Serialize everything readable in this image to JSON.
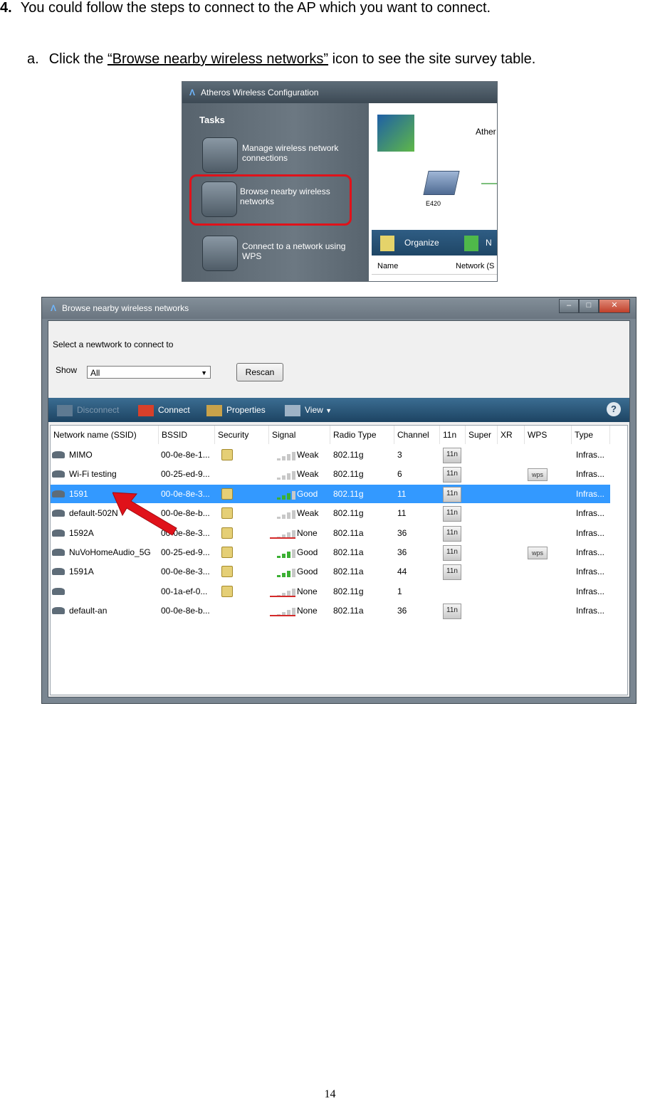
{
  "step": {
    "number": "4.",
    "text": "You could follow the steps to connect to the AP which you want to connect."
  },
  "substep": {
    "label": "a.",
    "before": "Click the ",
    "link": "“Browse nearby wireless networks”",
    "after": " icon to see the site survey table."
  },
  "screenshot1": {
    "window_title": "Atheros Wireless Configuration",
    "tasks_heading": "Tasks",
    "tasks": [
      {
        "label": "Manage wireless network connections",
        "icon": "network-manage-icon",
        "highlighted": false
      },
      {
        "label": "Browse nearby wireless networks",
        "icon": "magnifier-icon",
        "highlighted": true
      },
      {
        "label": "Connect to a network using WPS",
        "icon": "wps-lock-icon",
        "highlighted": false
      }
    ],
    "brand_text": "Ather",
    "laptop_label": "E420",
    "toolbar": {
      "organize": "Organize",
      "n": "N"
    },
    "columns": [
      "Name",
      "Network (S"
    ],
    "highlight_color": "#e0121a"
  },
  "screenshot2": {
    "window_title": "Browse nearby wireless networks",
    "prompt": "Select a newtwork to connect to",
    "show_label": "Show",
    "show_value": "All",
    "rescan_label": "Rescan",
    "toolbar": {
      "disconnect": "Disconnect",
      "connect": "Connect",
      "properties": "Properties",
      "view": "View"
    },
    "columns": [
      "Network name (SSID)",
      "BSSID",
      "Security",
      "Signal",
      "Radio Type",
      "Channel",
      "11n",
      "Super",
      "XR",
      "WPS",
      "Type"
    ],
    "networks": [
      {
        "ssid": "MIMO",
        "bssid": "00-0e-8e-1...",
        "secured": true,
        "signal": "Weak",
        "bars": 1,
        "radio": "802.11g",
        "channel": "3",
        "n11": true,
        "wps": false,
        "type": "Infras...",
        "selected": false
      },
      {
        "ssid": "Wi-Fi testing",
        "bssid": "00-25-ed-9...",
        "secured": false,
        "signal": "Weak",
        "bars": 1,
        "radio": "802.11g",
        "channel": "6",
        "n11": true,
        "wps": true,
        "type": "Infras...",
        "selected": false
      },
      {
        "ssid": "1591",
        "bssid": "00-0e-8e-3...",
        "secured": true,
        "signal": "Good",
        "bars": 3,
        "radio": "802.11g",
        "channel": "11",
        "n11": true,
        "wps": false,
        "type": "Infras...",
        "selected": true
      },
      {
        "ssid": "default-502N",
        "bssid": "00-0e-8e-b...",
        "secured": true,
        "signal": "Weak",
        "bars": 1,
        "radio": "802.11g",
        "channel": "11",
        "n11": true,
        "wps": false,
        "type": "Infras...",
        "selected": false
      },
      {
        "ssid": "1592A",
        "bssid": "00-0e-8e-3...",
        "secured": true,
        "signal": "None",
        "bars": 0,
        "radio": "802.11a",
        "channel": "36",
        "n11": true,
        "wps": false,
        "type": "Infras...",
        "selected": false
      },
      {
        "ssid": "NuVoHomeAudio_5G",
        "bssid": "00-25-ed-9...",
        "secured": true,
        "signal": "Good",
        "bars": 3,
        "radio": "802.11a",
        "channel": "36",
        "n11": true,
        "wps": true,
        "type": "Infras...",
        "selected": false
      },
      {
        "ssid": "1591A",
        "bssid": "00-0e-8e-3...",
        "secured": true,
        "signal": "Good",
        "bars": 3,
        "radio": "802.11a",
        "channel": "44",
        "n11": true,
        "wps": false,
        "type": "Infras...",
        "selected": false
      },
      {
        "ssid": "",
        "bssid": "00-1a-ef-0...",
        "secured": true,
        "signal": "None",
        "bars": 0,
        "radio": "802.11g",
        "channel": "1",
        "n11": false,
        "wps": false,
        "type": "Infras...",
        "selected": false
      },
      {
        "ssid": "default-an",
        "bssid": "00-0e-8e-b...",
        "secured": false,
        "signal": "None",
        "bars": 0,
        "radio": "802.11a",
        "channel": "36",
        "n11": true,
        "wps": false,
        "type": "Infras...",
        "selected": false
      }
    ],
    "n11_icon_text": "11n",
    "wps_icon_text": "wps",
    "selection_color": "#3399ff",
    "arrow_color": "#e0121a"
  },
  "page_number": "14"
}
